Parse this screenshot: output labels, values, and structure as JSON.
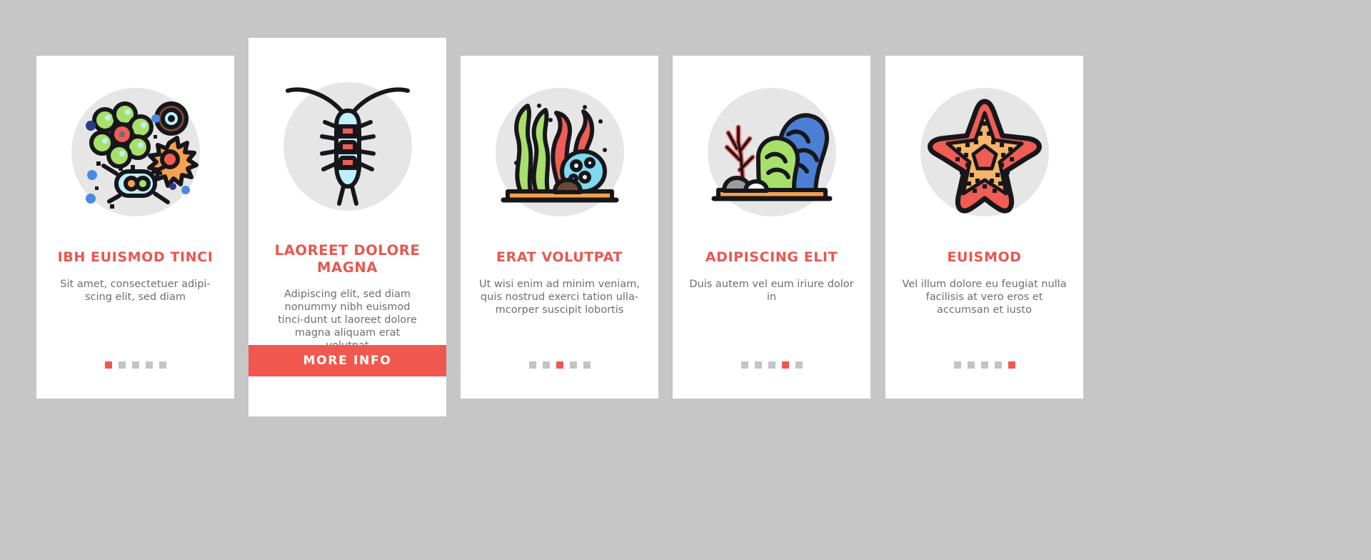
{
  "theme": {
    "background": "#c6c6c6",
    "card_background": "#ffffff",
    "accent": "#f0584f",
    "title_color": "#e8574f",
    "body_color": "#6d6e71",
    "icon_circle": "#e6e6e6",
    "dot_inactive": "#c4c4c4"
  },
  "cards": [
    {
      "id": "card-1",
      "icon_name": "microorganisms-icon",
      "title": "IBH EUISMOD TINCI",
      "body": "Sit amet, consectetuer adipi-scing elit, sed diam",
      "featured": false,
      "dots": {
        "count": 5,
        "active_index": 0
      }
    },
    {
      "id": "card-2",
      "icon_name": "plankton-copepod-icon",
      "title": "LAOREET DOLORE MAGNA",
      "body": "Adipiscing elit, sed diam nonummy nibh euismod tinci-dunt ut laoreet dolore magna aliquam erat volutpat",
      "featured": true,
      "button_label": "MORE INFO"
    },
    {
      "id": "card-3",
      "icon_name": "seaweed-anemone-icon",
      "title": "ERAT VOLUTPAT",
      "body": "Ut wisi enim ad minim veniam, quis nostrud exerci tation ulla-mcorper suscipit lobortis",
      "featured": false,
      "dots": {
        "count": 5,
        "active_index": 2
      }
    },
    {
      "id": "card-4",
      "icon_name": "coral-reef-icon",
      "title": "ADIPISCING ELIT",
      "body": "Duis autem vel eum iriure dolor in",
      "featured": false,
      "dots": {
        "count": 5,
        "active_index": 3
      }
    },
    {
      "id": "card-5",
      "icon_name": "starfish-icon",
      "title": "EUISMOD",
      "body": "Vel illum dolore eu feugiat nulla facilisis at vero eros et accumsan et iusto",
      "featured": false,
      "dots": {
        "count": 5,
        "active_index": 4
      }
    }
  ]
}
